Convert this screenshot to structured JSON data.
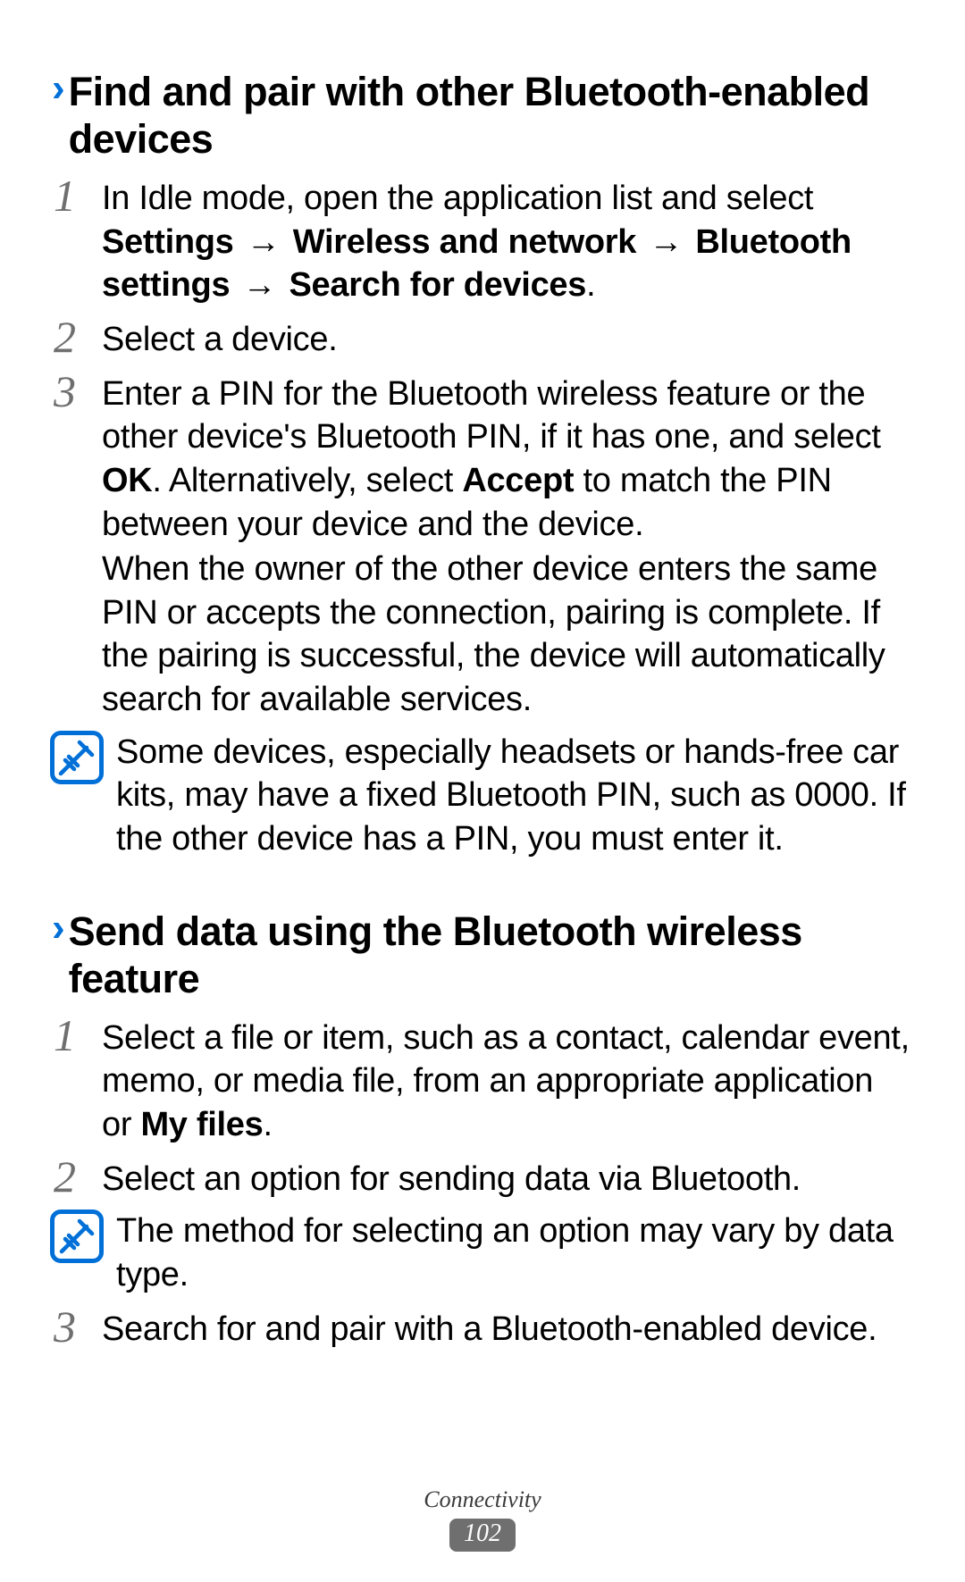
{
  "section1": {
    "title": "Find and pair with other Bluetooth-enabled devices",
    "step1": {
      "num": "1",
      "lead": "In Idle mode, open the application list and select ",
      "settings": "Settings",
      "arrow": " → ",
      "wireless": "Wireless and network",
      "bluetooth": "Bluetooth settings",
      "search": "Search for devices",
      "period": "."
    },
    "step2": {
      "num": "2",
      "text": "Select a device."
    },
    "step3": {
      "num": "3",
      "p1a": "Enter a PIN for the Bluetooth wireless feature or the other device's Bluetooth PIN, if it has one, and select ",
      "ok": "OK",
      "p1b": ". Alternatively, select ",
      "accept": "Accept",
      "p1c": " to match the PIN between your device and the device.",
      "p2": "When the owner of the other device enters the same PIN or accepts the connection, pairing is complete. If the pairing is successful, the device will automatically search for available services."
    },
    "note": "Some devices, especially headsets or hands-free car kits, may have a fixed Bluetooth PIN, such as 0000. If the other device has a PIN, you must enter it."
  },
  "section2": {
    "title": "Send data using the Bluetooth wireless feature",
    "step1": {
      "num": "1",
      "a": "Select a file or item, such as a contact, calendar event, memo, or media file, from an appropriate application or ",
      "myfiles": "My files",
      "b": "."
    },
    "step2": {
      "num": "2",
      "text": "Select an option for sending data via Bluetooth."
    },
    "note": "The method for selecting an option may vary by data type.",
    "step3": {
      "num": "3",
      "text": "Search for and pair with a Bluetooth-enabled device."
    }
  },
  "footer": {
    "section": "Connectivity",
    "page": "102"
  }
}
